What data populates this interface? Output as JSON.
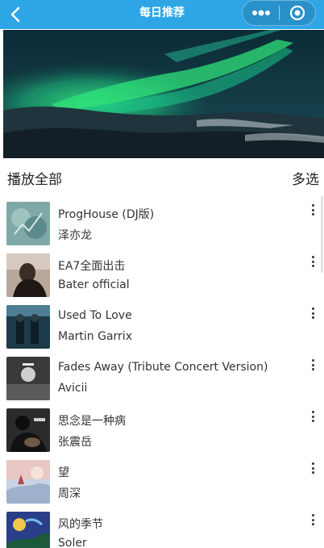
{
  "header": {
    "title": "每日推荐",
    "back_icon": "chevron-left-icon",
    "more_icon": "more-dots-icon",
    "close_icon": "target-circle-icon",
    "color": "#2ea6e6"
  },
  "banner": {
    "image": "aurora-over-mountains"
  },
  "list_header": {
    "play_all": "播放全部",
    "multi_select": "多选"
  },
  "songs": [
    {
      "title": "ProgHouse (DJ版)",
      "artist": "泽亦龙"
    },
    {
      "title": "EA7全面出击",
      "artist": "Bater official"
    },
    {
      "title": "Used To Love",
      "artist": "Martin Garrix"
    },
    {
      "title": "Fades Away (Tribute Concert Version)",
      "artist": "Avicii"
    },
    {
      "title": "思念是一种病",
      "artist": "张震岳"
    },
    {
      "title": "望",
      "artist": "周深"
    },
    {
      "title": "风的季节",
      "artist": "Soler"
    }
  ]
}
